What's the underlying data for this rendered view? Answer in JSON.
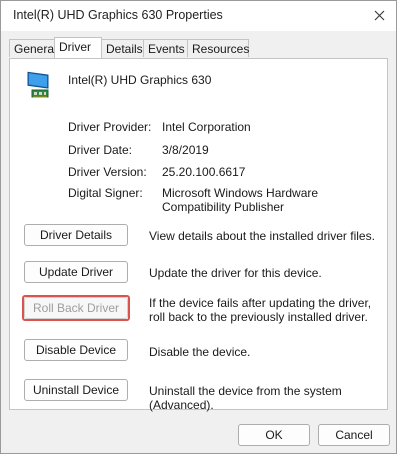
{
  "window": {
    "title": "Intel(R) UHD Graphics 630 Properties"
  },
  "tabs": [
    {
      "label": "General"
    },
    {
      "label": "Driver",
      "active": true
    },
    {
      "label": "Details"
    },
    {
      "label": "Events"
    },
    {
      "label": "Resources"
    }
  ],
  "device": {
    "name": "Intel(R) UHD Graphics 630",
    "icon": "display-adapter-icon"
  },
  "info": {
    "provider_label": "Driver Provider:",
    "provider_value": "Intel Corporation",
    "date_label": "Driver Date:",
    "date_value": "3/8/2019",
    "version_label": "Driver Version:",
    "version_value": "25.20.100.6617",
    "signer_label": "Digital Signer:",
    "signer_value": "Microsoft Windows Hardware Compatibility Publisher"
  },
  "actions": {
    "details_label": "Driver Details",
    "details_desc": "View details about the installed driver files.",
    "update_label": "Update Driver",
    "update_desc": "Update the driver for this device.",
    "rollback_label": "Roll Back Driver",
    "rollback_desc": "If the device fails after updating the driver, roll back to the previously installed driver.",
    "rollback_enabled": false,
    "disable_label": "Disable Device",
    "disable_desc": "Disable the device.",
    "uninstall_label": "Uninstall Device",
    "uninstall_desc": "Uninstall the device from the system (Advanced)."
  },
  "footer": {
    "ok_label": "OK",
    "cancel_label": "Cancel"
  },
  "colors": {
    "highlight": "#d9534f"
  }
}
